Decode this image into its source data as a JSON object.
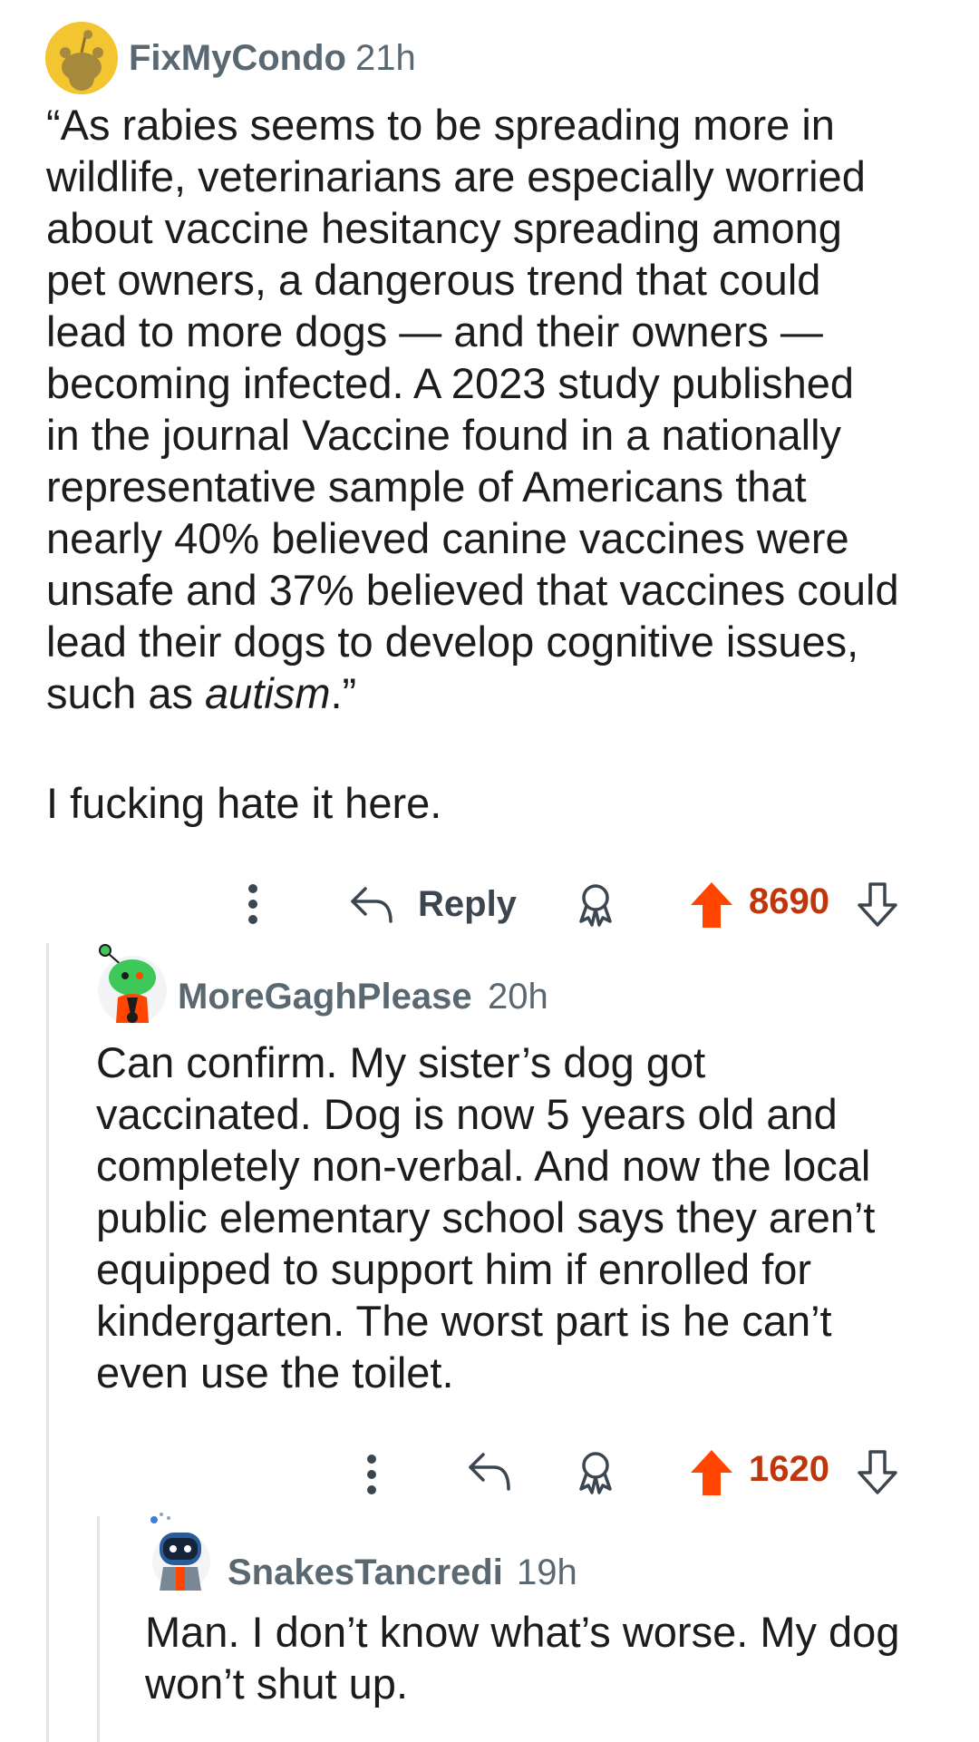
{
  "comments": [
    {
      "username": "FixMyCondo",
      "time": "21h",
      "avatar_icon": "snoo-avatar-gold",
      "body_lines": [
        "“As rabies seems to be spreading more in",
        "wildlife, veterinarians are especially worried",
        "about vaccine hesitancy spreading among",
        "pet owners, a dangerous trend that could",
        "lead to more dogs — and their owners —",
        "becoming infected. A 2023 study published",
        "in the journal Vaccine found in a nationally",
        "representative sample of Americans that",
        "nearly 40% believed canine vaccines were",
        "unsafe and 37% believed that vaccines could",
        "lead their dogs to develop cognitive issues,"
      ],
      "body_last_prefix": "such as ",
      "body_last_italic": "autism",
      "body_last_suffix": ".”",
      "body_extra": "I fucking hate it here.",
      "reply_label": "Reply",
      "score": "8690"
    },
    {
      "username": "MoreGaghPlease",
      "time": "20h",
      "avatar_icon": "snoo-avatar-green",
      "body_lines": [
        "Can confirm. My sister’s dog got",
        "vaccinated. Dog is now 5 years old and",
        "completely non-verbal. And now the local",
        "public elementary school says they aren’t",
        "equipped to support him if enrolled for",
        "kindergarten. The worst part is he can’t",
        "even use the toilet."
      ],
      "score": "1620"
    },
    {
      "username": "SnakesTancredi",
      "time": "19h",
      "avatar_icon": "snoo-avatar-robot",
      "body_lines": [
        "Man. I don’t know what’s worse. My dog",
        "won’t shut up."
      ]
    }
  ],
  "colors": {
    "upvote_active": "#ff4500",
    "score_text": "#c0360c",
    "meta_text": "#5a6872",
    "body_text": "#1c1c1c",
    "thread_line": "#e2e5e8"
  }
}
